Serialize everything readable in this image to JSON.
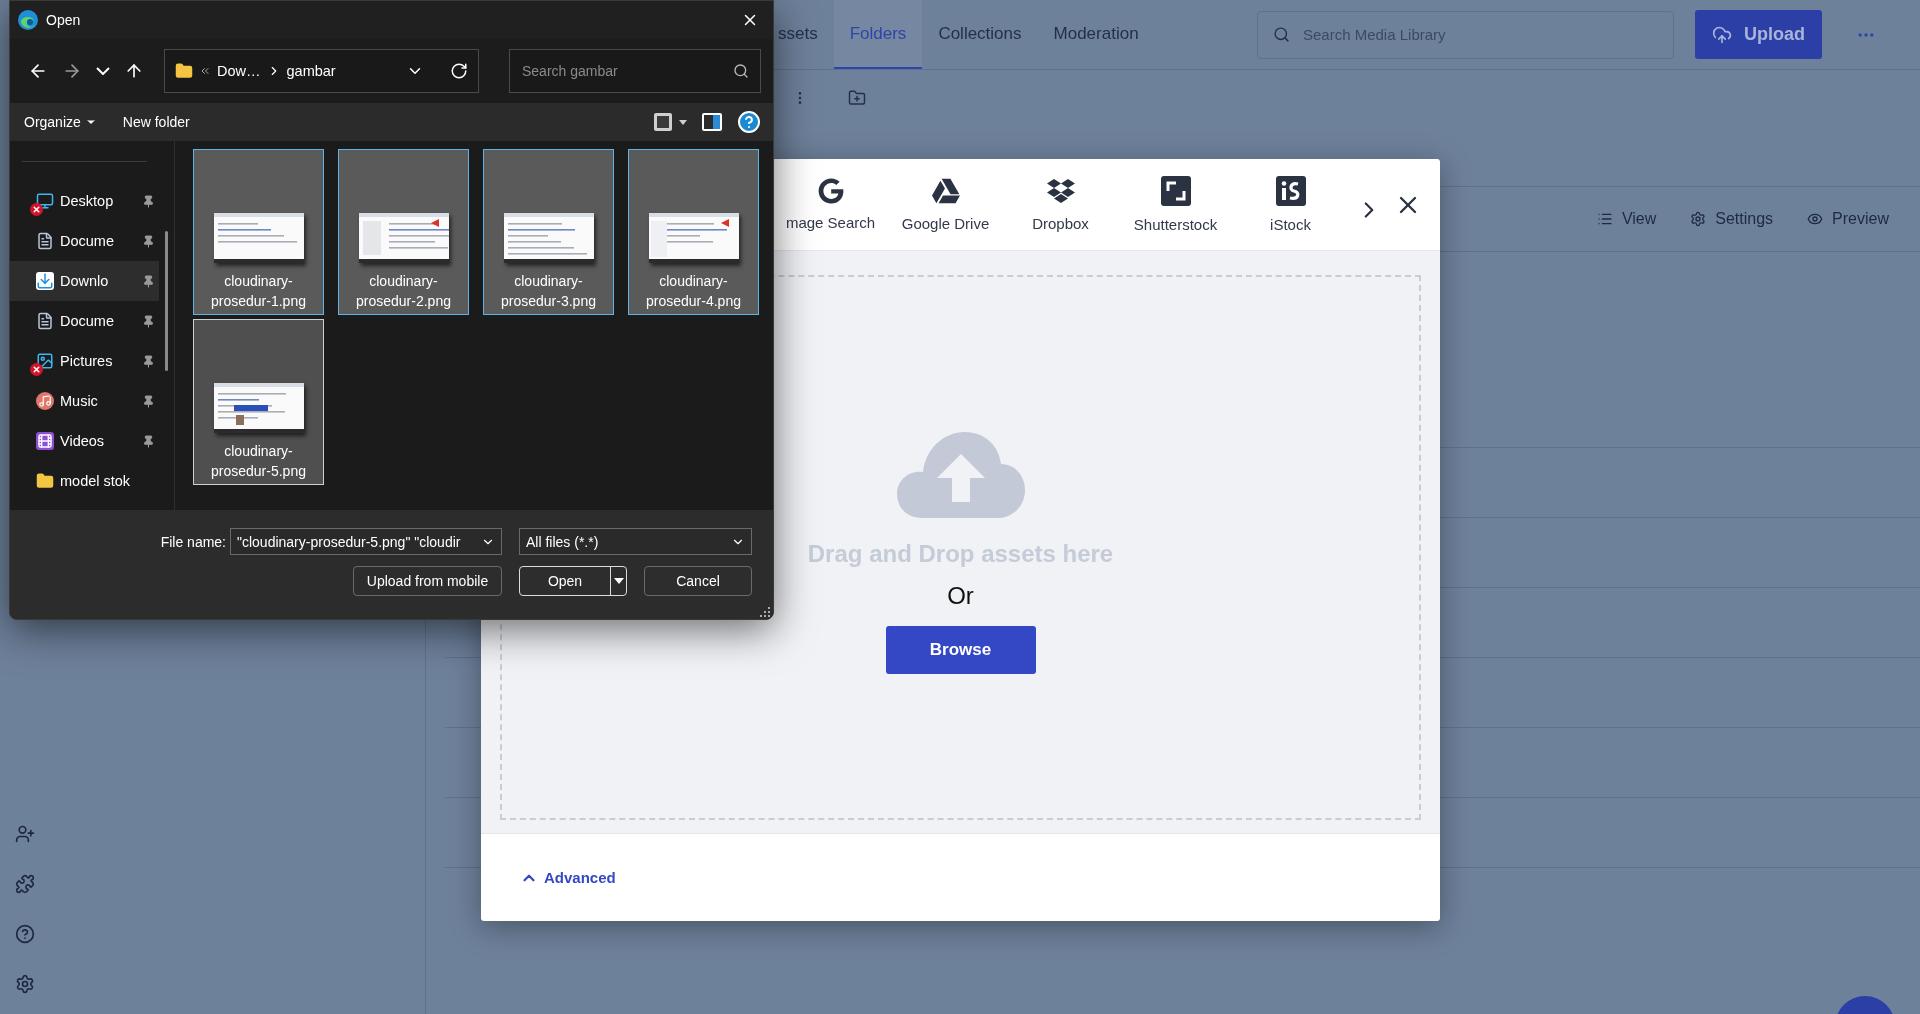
{
  "background_app": {
    "nav_tabs": [
      {
        "label": "ssets",
        "selected": false
      },
      {
        "label": "Folders",
        "selected": true
      },
      {
        "label": "Collections",
        "selected": false
      },
      {
        "label": "Moderation",
        "selected": false
      }
    ],
    "search": {
      "placeholder": "Search Media Library"
    },
    "upload_button": "Upload",
    "view_actions": [
      {
        "label": "View",
        "kind": "view"
      },
      {
        "label": "Settings",
        "kind": "settings"
      },
      {
        "label": "Preview",
        "kind": "preview"
      }
    ]
  },
  "upload_modal": {
    "sources": [
      {
        "label": "mage Search",
        "kind": "google"
      },
      {
        "label": "Google Drive",
        "kind": "drive"
      },
      {
        "label": "Dropbox",
        "kind": "dropbox"
      },
      {
        "label": "Shutterstock",
        "kind": "shutterstock"
      },
      {
        "label": "iStock",
        "kind": "istock"
      }
    ],
    "drop_text": "Drag and Drop assets here",
    "or_text": "Or",
    "browse_button": "Browse",
    "advanced_link": "Advanced"
  },
  "open_dialog": {
    "title": "Open",
    "path": [
      "Dow…",
      "gambar"
    ],
    "search": {
      "placeholder": "Search gambar"
    },
    "commands": [
      {
        "label": "Organize",
        "kind": "menu"
      },
      {
        "label": "New folder",
        "kind": "plain"
      }
    ],
    "nav_items": [
      {
        "label": "Desktop",
        "kind": "desktop",
        "selected": false,
        "sync_error": true,
        "pinned": true
      },
      {
        "label": "Docume",
        "kind": "documents",
        "selected": false,
        "sync_error": false,
        "pinned": true
      },
      {
        "label": "Downlo",
        "kind": "downloads",
        "selected": true,
        "sync_error": false,
        "pinned": true
      },
      {
        "label": "Docume",
        "kind": "documents",
        "selected": false,
        "sync_error": false,
        "pinned": true
      },
      {
        "label": "Pictures",
        "kind": "pictures",
        "selected": false,
        "sync_error": true,
        "pinned": true
      },
      {
        "label": "Music",
        "kind": "music",
        "selected": false,
        "sync_error": false,
        "pinned": true
      },
      {
        "label": "Videos",
        "kind": "videos",
        "selected": false,
        "sync_error": false,
        "pinned": true
      },
      {
        "label": "model stok",
        "kind": "folder",
        "selected": false,
        "sync_error": false,
        "pinned": false
      }
    ],
    "files": [
      {
        "name": "cloudinary-prosedur-1.png",
        "selected": true,
        "focused": false
      },
      {
        "name": "cloudinary-prosedur-2.png",
        "selected": true,
        "focused": false
      },
      {
        "name": "cloudinary-prosedur-3.png",
        "selected": true,
        "focused": false
      },
      {
        "name": "cloudinary-prosedur-4.png",
        "selected": true,
        "focused": false
      },
      {
        "name": "cloudinary-prosedur-5.png",
        "selected": true,
        "focused": true
      }
    ],
    "file_name_label": "File name:",
    "file_name": "\"cloudinary-prosedur-5.png\" \"cloudir",
    "file_type": "All files (*.*)",
    "buttons": [
      {
        "label": "Upload from mobile",
        "kind": "plain"
      },
      {
        "label": "Open",
        "kind": "split"
      },
      {
        "label": "Cancel",
        "kind": "plain"
      }
    ]
  }
}
